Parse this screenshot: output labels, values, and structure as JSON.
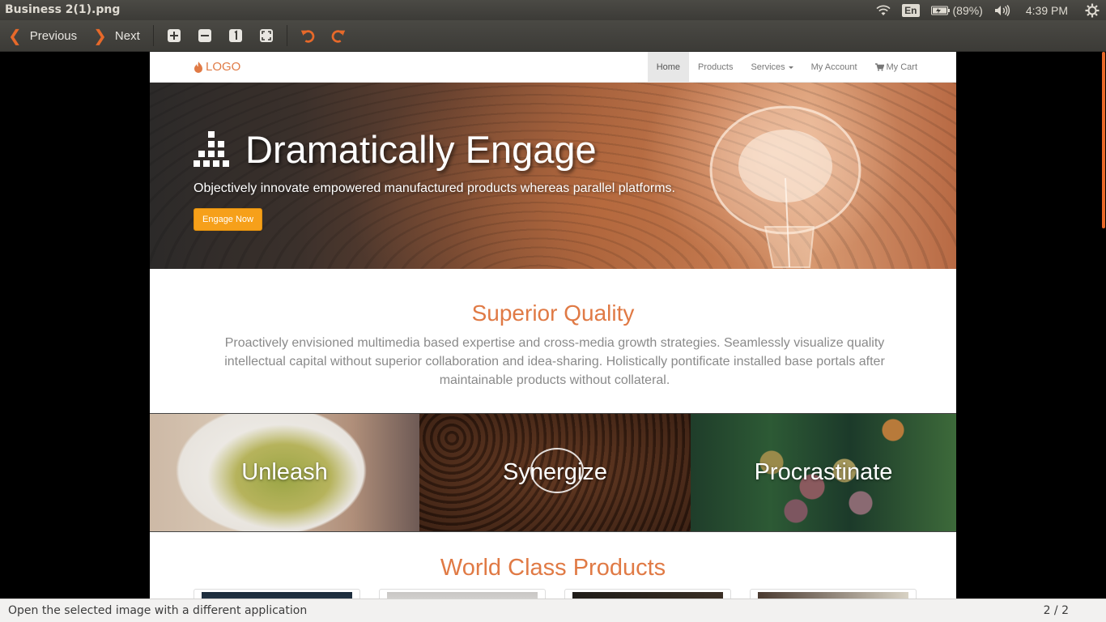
{
  "top_panel": {
    "window_title": "Business 2(1).png",
    "keyboard_layout": "En",
    "battery": "(89%)",
    "time": "4:39 PM"
  },
  "toolbar": {
    "previous_label": "Previous",
    "next_label": "Next",
    "icons": [
      "zoom-in-icon",
      "zoom-out-icon",
      "normal-size-icon",
      "best-fit-icon",
      "rotate-left-icon",
      "rotate-right-icon"
    ],
    "accent_color": "#e7692a"
  },
  "site": {
    "logo_text": "LOGO",
    "nav": {
      "home": "Home",
      "products": "Products",
      "services": "Services",
      "my_account": "My Account",
      "my_cart": "My Cart"
    },
    "hero": {
      "title": "Dramatically Engage",
      "subtitle": "Objectively innovate empowered manufactured products whereas parallel platforms.",
      "button": "Engage Now",
      "button_color": "#f6a01a"
    },
    "superior_quality": {
      "title": "Superior Quality",
      "text": "Proactively envisioned multimedia based expertise and cross-media growth strategies. Seamlessly visualize quality intellectual capital without superior collaboration and idea-sharing. Holistically pontificate installed base portals after maintainable products without collateral."
    },
    "tiles": [
      "Unleash",
      "Synergize",
      "Procrastinate"
    ],
    "world_class": {
      "title": "World Class Products"
    },
    "accent_color": "#e07a45"
  },
  "statusbar": {
    "message": "Open the selected image with a different application",
    "page_counter": "2 / 2"
  }
}
